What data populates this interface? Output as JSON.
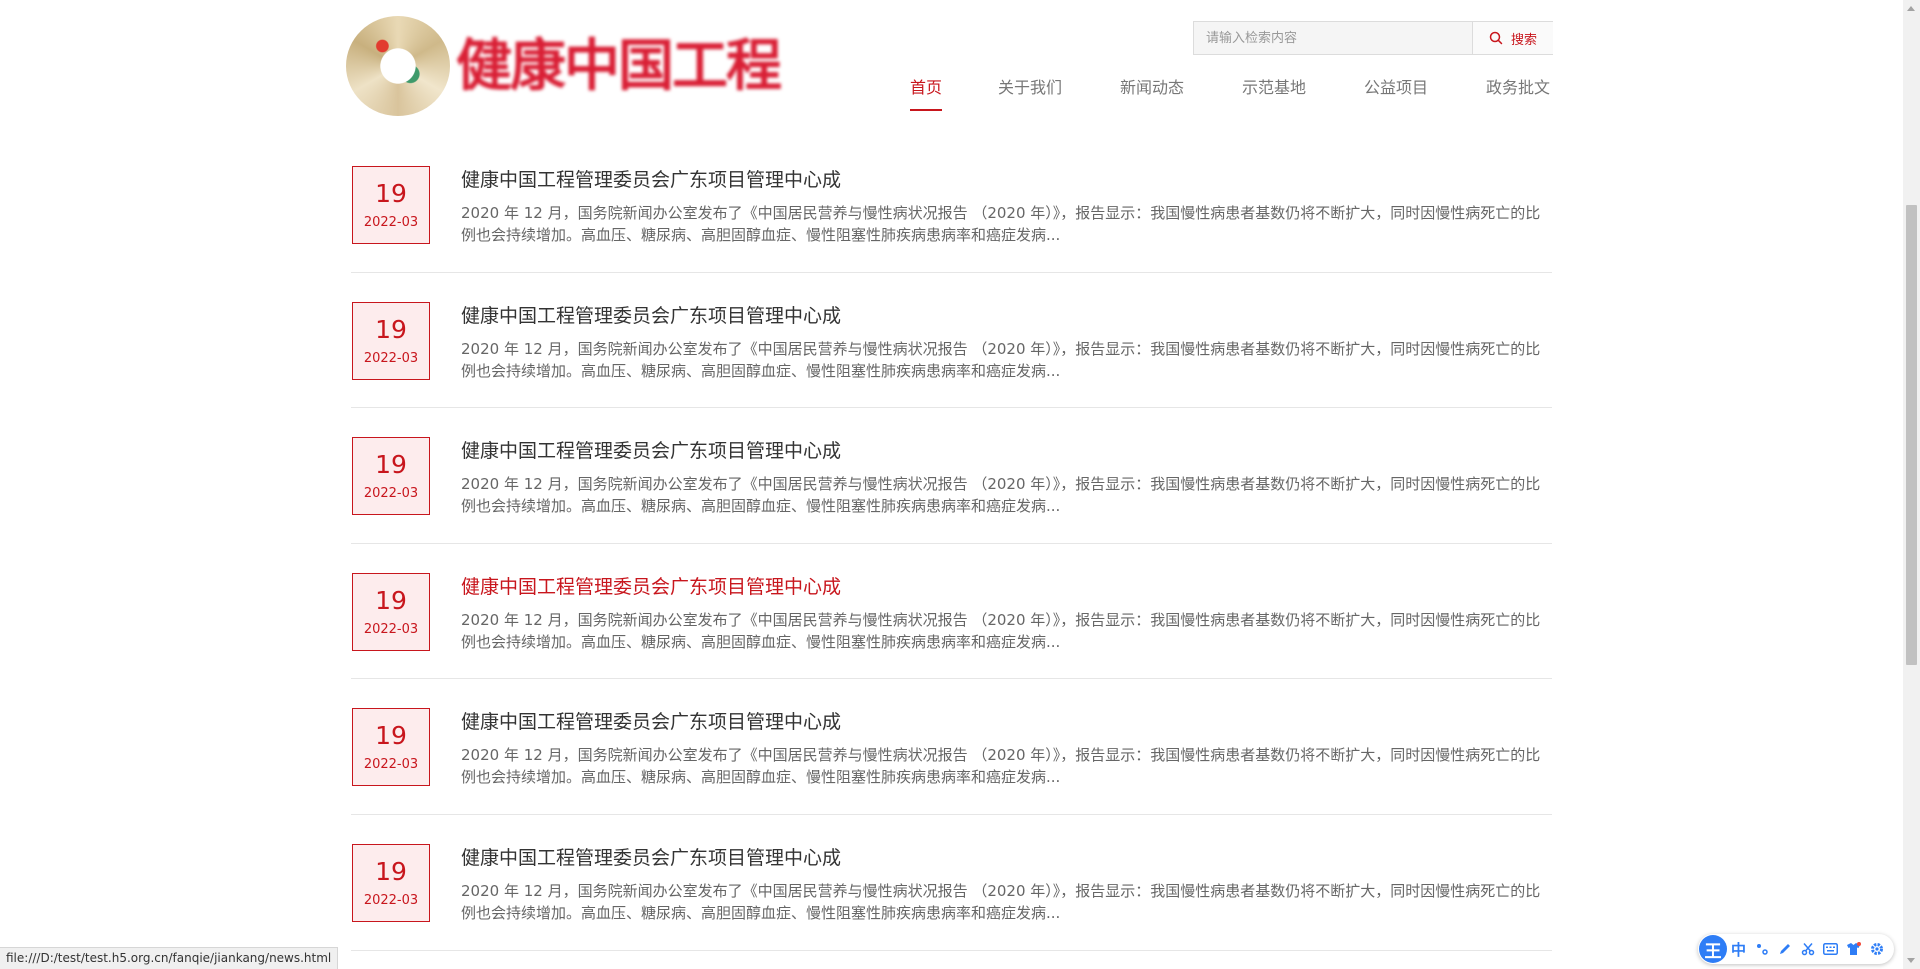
{
  "brand": {
    "name": "健康中国工程"
  },
  "search": {
    "placeholder": "请输入检索内容",
    "button_label": "搜索"
  },
  "nav": {
    "items": [
      {
        "label": "首页",
        "active": true
      },
      {
        "label": "关于我们"
      },
      {
        "label": "新闻动态"
      },
      {
        "label": "示范基地"
      },
      {
        "label": "公益项目"
      },
      {
        "label": "政务批文"
      }
    ]
  },
  "news": [
    {
      "day": "19",
      "ym": "2022-03",
      "title": "健康中国工程管理委员会广东项目管理中心成",
      "summary": "2020 年 12 月，国务院新闻办公室发布了《中国居民营养与慢性病状况报告 （2020 年）》，报告显示：我国慢性病患者基数仍将不断扩大，同时因慢性病死亡的比例也会持续增加。高血压、糖尿病、高胆固醇血症、慢性阻塞性肺疾病患病率和癌症发病..."
    },
    {
      "day": "19",
      "ym": "2022-03",
      "title": "健康中国工程管理委员会广东项目管理中心成",
      "summary": "2020 年 12 月，国务院新闻办公室发布了《中国居民营养与慢性病状况报告 （2020 年）》，报告显示：我国慢性病患者基数仍将不断扩大，同时因慢性病死亡的比例也会持续增加。高血压、糖尿病、高胆固醇血症、慢性阻塞性肺疾病患病率和癌症发病..."
    },
    {
      "day": "19",
      "ym": "2022-03",
      "title": "健康中国工程管理委员会广东项目管理中心成",
      "summary": "2020 年 12 月，国务院新闻办公室发布了《中国居民营养与慢性病状况报告 （2020 年）》，报告显示：我国慢性病患者基数仍将不断扩大，同时因慢性病死亡的比例也会持续增加。高血压、糖尿病、高胆固醇血症、慢性阻塞性肺疾病患病率和癌症发病..."
    },
    {
      "day": "19",
      "ym": "2022-03",
      "title": "健康中国工程管理委员会广东项目管理中心成",
      "summary": "2020 年 12 月，国务院新闻办公室发布了《中国居民营养与慢性病状况报告 （2020 年）》，报告显示：我国慢性病患者基数仍将不断扩大，同时因慢性病死亡的比例也会持续增加。高血压、糖尿病、高胆固醇血症、慢性阻塞性肺疾病患病率和癌症发病...",
      "hover": true
    },
    {
      "day": "19",
      "ym": "2022-03",
      "title": "健康中国工程管理委员会广东项目管理中心成",
      "summary": "2020 年 12 月，国务院新闻办公室发布了《中国居民营养与慢性病状况报告 （2020 年）》，报告显示：我国慢性病患者基数仍将不断扩大，同时因慢性病死亡的比例也会持续增加。高血压、糖尿病、高胆固醇血症、慢性阻塞性肺疾病患病率和癌症发病..."
    },
    {
      "day": "19",
      "ym": "2022-03",
      "title": "健康中国工程管理委员会广东项目管理中心成",
      "summary": "2020 年 12 月，国务院新闻办公室发布了《中国居民营养与慢性病状况报告 （2020 年）》，报告显示：我国慢性病患者基数仍将不断扩大，同时因慢性病死亡的比例也会持续增加。高血压、糖尿病、高胆固醇血症、慢性阻塞性肺疾病患病率和癌症发病..."
    }
  ],
  "status_url": "file:///D:/test/test.h5.org.cn/fanqie/jiankang/news.html",
  "ime": {
    "logo": "王",
    "mode": "中"
  },
  "colors": {
    "accent": "#c8161d",
    "date_bg": "#fdeced",
    "ime_blue": "#2e7df6"
  }
}
